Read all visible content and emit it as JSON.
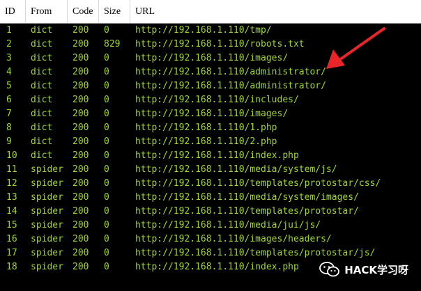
{
  "table": {
    "columns": [
      "ID",
      "From",
      "Code",
      "Size",
      "URL"
    ],
    "rows": [
      {
        "id": "1",
        "from": "dict",
        "code": "200",
        "size": "0",
        "url": "http://192.168.1.110/tmp/"
      },
      {
        "id": "2",
        "from": "dict",
        "code": "200",
        "size": "829",
        "url": "http://192.168.1.110/robots.txt"
      },
      {
        "id": "3",
        "from": "dict",
        "code": "200",
        "size": "0",
        "url": "http://192.168.1.110/images/"
      },
      {
        "id": "4",
        "from": "dict",
        "code": "200",
        "size": "0",
        "url": "http://192.168.1.110/administrator/"
      },
      {
        "id": "5",
        "from": "dict",
        "code": "200",
        "size": "0",
        "url": "http://192.168.1.110/administrator/"
      },
      {
        "id": "6",
        "from": "dict",
        "code": "200",
        "size": "0",
        "url": "http://192.168.1.110/includes/"
      },
      {
        "id": "7",
        "from": "dict",
        "code": "200",
        "size": "0",
        "url": "http://192.168.1.110/images/"
      },
      {
        "id": "8",
        "from": "dict",
        "code": "200",
        "size": "0",
        "url": "http://192.168.1.110/1.php"
      },
      {
        "id": "9",
        "from": "dict",
        "code": "200",
        "size": "0",
        "url": "http://192.168.1.110/2.php"
      },
      {
        "id": "10",
        "from": "dict",
        "code": "200",
        "size": "0",
        "url": "http://192.168.1.110/index.php"
      },
      {
        "id": "11",
        "from": "spider",
        "code": "200",
        "size": "0",
        "url": "http://192.168.1.110/media/system/js/"
      },
      {
        "id": "12",
        "from": "spider",
        "code": "200",
        "size": "0",
        "url": "http://192.168.1.110/templates/protostar/css/"
      },
      {
        "id": "13",
        "from": "spider",
        "code": "200",
        "size": "0",
        "url": "http://192.168.1.110/media/system/images/"
      },
      {
        "id": "14",
        "from": "spider",
        "code": "200",
        "size": "0",
        "url": "http://192.168.1.110/templates/protostar/"
      },
      {
        "id": "15",
        "from": "spider",
        "code": "200",
        "size": "0",
        "url": "http://192.168.1.110/media/jui/js/"
      },
      {
        "id": "16",
        "from": "spider",
        "code": "200",
        "size": "0",
        "url": "http://192.168.1.110/images/headers/"
      },
      {
        "id": "17",
        "from": "spider",
        "code": "200",
        "size": "0",
        "url": "http://192.168.1.110/templates/protostar/js/"
      },
      {
        "id": "18",
        "from": "spider",
        "code": "200",
        "size": "0",
        "url": "http://192.168.1.110/index.php"
      }
    ]
  },
  "annotation": {
    "arrow_icon": "red-arrow-icon",
    "arrow_color": "#e8262a"
  },
  "watermark": {
    "text": "HACK学习呀",
    "icon": "wechat-icon"
  },
  "colors": {
    "background": "#000000",
    "row_text": "#9fd82a",
    "header_bg": "#ffffff"
  }
}
